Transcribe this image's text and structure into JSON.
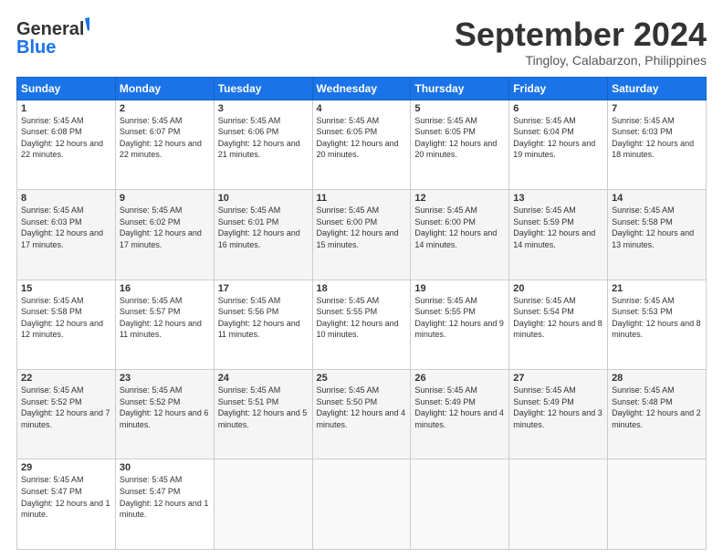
{
  "header": {
    "logo_general": "General",
    "logo_blue": "Blue",
    "month_title": "September 2024",
    "location": "Tingloy, Calabarzon, Philippines"
  },
  "weekdays": [
    "Sunday",
    "Monday",
    "Tuesday",
    "Wednesday",
    "Thursday",
    "Friday",
    "Saturday"
  ],
  "weeks": [
    [
      {
        "day": "1",
        "sunrise": "Sunrise: 5:45 AM",
        "sunset": "Sunset: 6:08 PM",
        "daylight": "Daylight: 12 hours and 22 minutes."
      },
      {
        "day": "2",
        "sunrise": "Sunrise: 5:45 AM",
        "sunset": "Sunset: 6:07 PM",
        "daylight": "Daylight: 12 hours and 22 minutes."
      },
      {
        "day": "3",
        "sunrise": "Sunrise: 5:45 AM",
        "sunset": "Sunset: 6:06 PM",
        "daylight": "Daylight: 12 hours and 21 minutes."
      },
      {
        "day": "4",
        "sunrise": "Sunrise: 5:45 AM",
        "sunset": "Sunset: 6:05 PM",
        "daylight": "Daylight: 12 hours and 20 minutes."
      },
      {
        "day": "5",
        "sunrise": "Sunrise: 5:45 AM",
        "sunset": "Sunset: 6:05 PM",
        "daylight": "Daylight: 12 hours and 20 minutes."
      },
      {
        "day": "6",
        "sunrise": "Sunrise: 5:45 AM",
        "sunset": "Sunset: 6:04 PM",
        "daylight": "Daylight: 12 hours and 19 minutes."
      },
      {
        "day": "7",
        "sunrise": "Sunrise: 5:45 AM",
        "sunset": "Sunset: 6:03 PM",
        "daylight": "Daylight: 12 hours and 18 minutes."
      }
    ],
    [
      {
        "day": "8",
        "sunrise": "Sunrise: 5:45 AM",
        "sunset": "Sunset: 6:03 PM",
        "daylight": "Daylight: 12 hours and 17 minutes."
      },
      {
        "day": "9",
        "sunrise": "Sunrise: 5:45 AM",
        "sunset": "Sunset: 6:02 PM",
        "daylight": "Daylight: 12 hours and 17 minutes."
      },
      {
        "day": "10",
        "sunrise": "Sunrise: 5:45 AM",
        "sunset": "Sunset: 6:01 PM",
        "daylight": "Daylight: 12 hours and 16 minutes."
      },
      {
        "day": "11",
        "sunrise": "Sunrise: 5:45 AM",
        "sunset": "Sunset: 6:00 PM",
        "daylight": "Daylight: 12 hours and 15 minutes."
      },
      {
        "day": "12",
        "sunrise": "Sunrise: 5:45 AM",
        "sunset": "Sunset: 6:00 PM",
        "daylight": "Daylight: 12 hours and 14 minutes."
      },
      {
        "day": "13",
        "sunrise": "Sunrise: 5:45 AM",
        "sunset": "Sunset: 5:59 PM",
        "daylight": "Daylight: 12 hours and 14 minutes."
      },
      {
        "day": "14",
        "sunrise": "Sunrise: 5:45 AM",
        "sunset": "Sunset: 5:58 PM",
        "daylight": "Daylight: 12 hours and 13 minutes."
      }
    ],
    [
      {
        "day": "15",
        "sunrise": "Sunrise: 5:45 AM",
        "sunset": "Sunset: 5:58 PM",
        "daylight": "Daylight: 12 hours and 12 minutes."
      },
      {
        "day": "16",
        "sunrise": "Sunrise: 5:45 AM",
        "sunset": "Sunset: 5:57 PM",
        "daylight": "Daylight: 12 hours and 11 minutes."
      },
      {
        "day": "17",
        "sunrise": "Sunrise: 5:45 AM",
        "sunset": "Sunset: 5:56 PM",
        "daylight": "Daylight: 12 hours and 11 minutes."
      },
      {
        "day": "18",
        "sunrise": "Sunrise: 5:45 AM",
        "sunset": "Sunset: 5:55 PM",
        "daylight": "Daylight: 12 hours and 10 minutes."
      },
      {
        "day": "19",
        "sunrise": "Sunrise: 5:45 AM",
        "sunset": "Sunset: 5:55 PM",
        "daylight": "Daylight: 12 hours and 9 minutes."
      },
      {
        "day": "20",
        "sunrise": "Sunrise: 5:45 AM",
        "sunset": "Sunset: 5:54 PM",
        "daylight": "Daylight: 12 hours and 8 minutes."
      },
      {
        "day": "21",
        "sunrise": "Sunrise: 5:45 AM",
        "sunset": "Sunset: 5:53 PM",
        "daylight": "Daylight: 12 hours and 8 minutes."
      }
    ],
    [
      {
        "day": "22",
        "sunrise": "Sunrise: 5:45 AM",
        "sunset": "Sunset: 5:52 PM",
        "daylight": "Daylight: 12 hours and 7 minutes."
      },
      {
        "day": "23",
        "sunrise": "Sunrise: 5:45 AM",
        "sunset": "Sunset: 5:52 PM",
        "daylight": "Daylight: 12 hours and 6 minutes."
      },
      {
        "day": "24",
        "sunrise": "Sunrise: 5:45 AM",
        "sunset": "Sunset: 5:51 PM",
        "daylight": "Daylight: 12 hours and 5 minutes."
      },
      {
        "day": "25",
        "sunrise": "Sunrise: 5:45 AM",
        "sunset": "Sunset: 5:50 PM",
        "daylight": "Daylight: 12 hours and 4 minutes."
      },
      {
        "day": "26",
        "sunrise": "Sunrise: 5:45 AM",
        "sunset": "Sunset: 5:49 PM",
        "daylight": "Daylight: 12 hours and 4 minutes."
      },
      {
        "day": "27",
        "sunrise": "Sunrise: 5:45 AM",
        "sunset": "Sunset: 5:49 PM",
        "daylight": "Daylight: 12 hours and 3 minutes."
      },
      {
        "day": "28",
        "sunrise": "Sunrise: 5:45 AM",
        "sunset": "Sunset: 5:48 PM",
        "daylight": "Daylight: 12 hours and 2 minutes."
      }
    ],
    [
      {
        "day": "29",
        "sunrise": "Sunrise: 5:45 AM",
        "sunset": "Sunset: 5:47 PM",
        "daylight": "Daylight: 12 hours and 1 minute."
      },
      {
        "day": "30",
        "sunrise": "Sunrise: 5:45 AM",
        "sunset": "Sunset: 5:47 PM",
        "daylight": "Daylight: 12 hours and 1 minute."
      },
      null,
      null,
      null,
      null,
      null
    ]
  ]
}
